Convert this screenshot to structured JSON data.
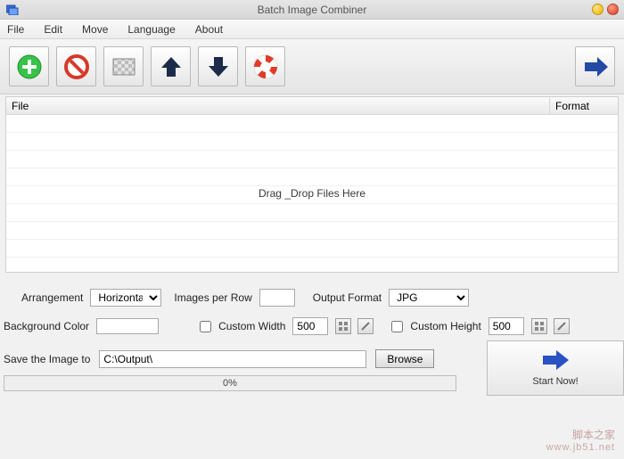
{
  "window": {
    "title": "Batch Image Combiner"
  },
  "menu": {
    "file": "File",
    "edit": "Edit",
    "move": "Move",
    "language": "Language",
    "about": "About"
  },
  "grid": {
    "file_header": "File",
    "format_header": "Format",
    "drop_hint": "Drag _Drop Files Here"
  },
  "options": {
    "arrangement_label": "Arrangement",
    "arrangement_value": "Horizontal",
    "images_per_row_label": "Images per Row",
    "images_per_row_value": "",
    "output_format_label": "Output Format",
    "output_format_value": "JPG",
    "bg_color_label": "Background Color",
    "custom_width_label": "Custom Width",
    "custom_width_value": "500",
    "custom_height_label": "Custom Height",
    "custom_height_value": "500"
  },
  "save": {
    "label": "Save the Image to",
    "path": "C:\\Output\\",
    "browse": "Browse",
    "start": "Start Now!",
    "progress": "0%"
  },
  "watermark": {
    "line1": "脚本之家",
    "line2": "www.jb51.net"
  }
}
